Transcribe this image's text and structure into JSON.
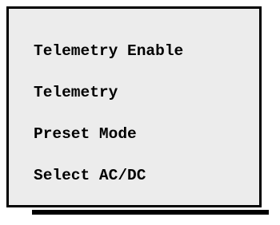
{
  "menu": {
    "items": [
      {
        "label": "Telemetry Enable"
      },
      {
        "label": "Telemetry"
      },
      {
        "label": "Preset Mode"
      },
      {
        "label": "Select AC/DC"
      }
    ]
  }
}
